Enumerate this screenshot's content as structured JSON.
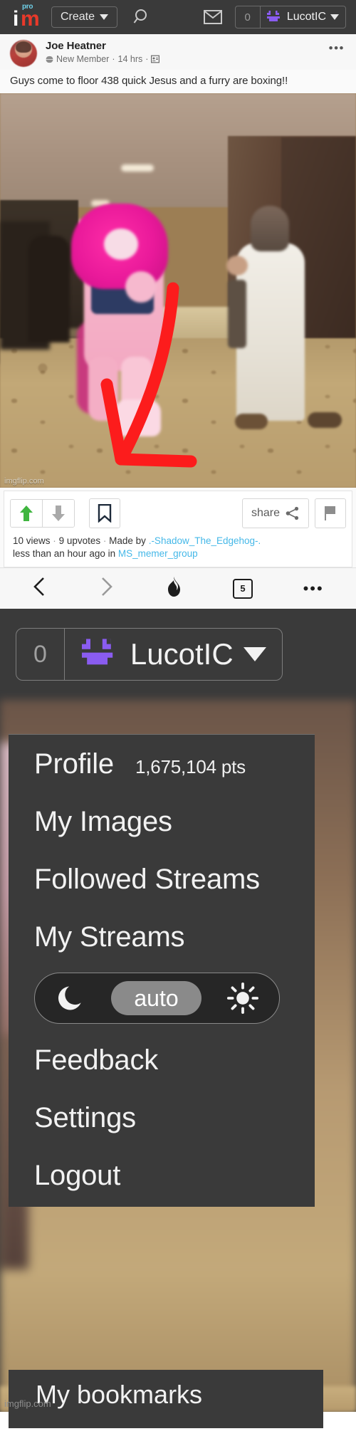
{
  "header": {
    "logo_text_i": "i",
    "logo_text_m": "m",
    "logo_badge": "pro",
    "create_label": "Create",
    "search_icon": "search-icon",
    "mail_icon": "envelope-icon",
    "notification_count": "0",
    "username": "LucotIC",
    "avatar_icon": "smiley-avatar-icon"
  },
  "post": {
    "author": "Joe Heatner",
    "badge_icon": "globe-icon",
    "member_status": "New Member",
    "separator": "·",
    "time_ago": "14 hrs",
    "privacy_icon": "id-card-icon",
    "more_icon": "more-options-icon",
    "title": "Guys come to floor 438 quick Jesus and a furry are boxing!!",
    "watermark": "imgflip.com"
  },
  "votebar": {
    "upvote_icon": "up-arrow-icon",
    "downvote_icon": "down-arrow-icon",
    "bookmark_icon": "bookmark-icon",
    "share_label": "share",
    "share_icon": "share-nodes-icon",
    "flag_icon": "flag-icon"
  },
  "stats": {
    "views": "10 views",
    "sep1": "·",
    "upvotes": "9 upvotes",
    "sep2": "·",
    "made_by_label": "Made by",
    "made_by_user": ".-Shadow_The_Edgehog-.",
    "time_prefix": "less than an hour ago in",
    "stream": "MS_memer_group"
  },
  "browser_nav": {
    "back_icon": "chevron-left-icon",
    "forward_icon": "chevron-right-icon",
    "hot_icon": "flame-icon",
    "tab_count": "5",
    "menu_icon": "more-horizontal-icon"
  },
  "zoom_panel": {
    "notification_count": "0",
    "username": "LucotIC",
    "avatar_icon": "smiley-avatar-icon",
    "caret_icon": "chevron-down-icon"
  },
  "dropdown": {
    "items": [
      {
        "label": "Profile",
        "points": "1,675,104 pts"
      },
      {
        "label": "My Images"
      },
      {
        "label": "Followed Streams"
      },
      {
        "label": "My Streams"
      }
    ],
    "theme": {
      "dark_icon": "moon-icon",
      "auto_label": "auto",
      "light_icon": "sun-icon"
    },
    "items_after": [
      {
        "label": "Feedback"
      },
      {
        "label": "Settings"
      },
      {
        "label": "Logout"
      }
    ],
    "bookmarks_label": "My bookmarks"
  },
  "bottom": {
    "watermark": "imgflip.com"
  },
  "colors": {
    "header_bg": "#3a3a3a",
    "accent_purple": "#8a5cf0",
    "logo_red": "#e8392a",
    "link_blue": "#45b8e8",
    "upvote_green": "#3fb53f",
    "arrow_red": "#fc1c1c"
  }
}
